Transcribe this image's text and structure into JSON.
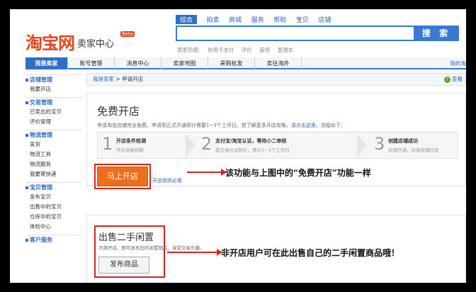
{
  "header": {
    "brand": "淘宝网",
    "subtitle": "卖家中心",
    "beta": "Beta",
    "search_tabs": [
      "综合",
      "拍卖",
      "商城",
      "服务",
      "帮助",
      "宝贝",
      "店铺"
    ],
    "search_button": "搜 索",
    "hot_label": "卖家热搜:",
    "hot_terms": [
      "信用卡支付",
      "评价",
      "装修",
      "直通车"
    ]
  },
  "nav": {
    "tabs": [
      "我是卖家",
      "账号管理",
      "消息中心",
      "卖家地图",
      "采购批发",
      "卖往海外"
    ],
    "right_link": "我的淘"
  },
  "sidebar": {
    "sections": [
      {
        "title": "店铺管理",
        "items": [
          "我要开店"
        ]
      },
      {
        "title": "交易管理",
        "items": [
          "已卖出的宝贝",
          "评价管理"
        ]
      },
      {
        "title": "物流管理",
        "items": [
          "发货",
          "物流工具",
          "物流服务",
          "我要寄快递"
        ]
      },
      {
        "title": "宝贝管理",
        "items": [
          "发布宝贝",
          "出售中的宝贝",
          "仓库中的宝贝",
          "体检中心"
        ]
      },
      {
        "title": "客户服务",
        "items": []
      }
    ]
  },
  "breadcrumb": {
    "root": "我是卖家",
    "sep": ">",
    "current": "申请开店",
    "help": "查看"
  },
  "free_store": {
    "title": "免费开店",
    "desc": "申请淘宝店铺完全免费，申请到正式开通预计需要1~3个工作日。想了解更多开店攻略，请",
    "desc_link": "点击这里",
    "desc_tail": "。流程如下：",
    "steps": [
      {
        "num": "1",
        "title": "开店条件检测",
        "desc": "开店资格判断"
      },
      {
        "num": "2",
        "title": "支付宝/淘宝认证，等待小二审核",
        "desc": "提交身份证照片，预计1~3个工作日"
      },
      {
        "num": "3",
        "title": "创建店铺成功",
        "desc": "店铺开通，完善店铺信息"
      }
    ],
    "button": "马上开店",
    "rule_link": "开店规则必看"
  },
  "idle_sale": {
    "title": "出售二手闲置",
    "desc": "不用开店，即可发布您的闲置物品，享受交易乐趣。",
    "button": "发布商品"
  },
  "annotations": {
    "a1": "该功能与上图中的“免费开店”功能一样",
    "a2": "非开店用户可在此出售自己的二手闲置商品哦！"
  }
}
